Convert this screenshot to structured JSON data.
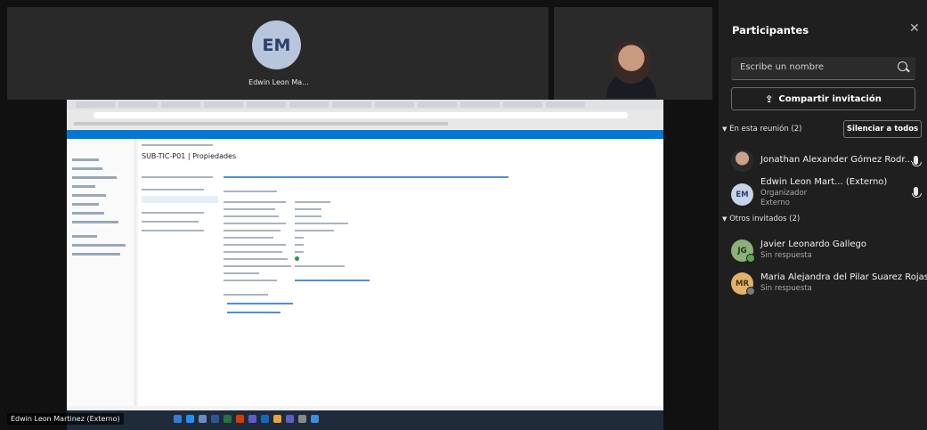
{
  "stage": {
    "main_tile": {
      "initials": "EM",
      "name": "Edwin Leon Ma..."
    },
    "presenter_label": "Edwin Leon Martinez (Externo)",
    "shared_screen": {
      "page_title": "SUB-TIC-P01 | Propiedades"
    }
  },
  "panel": {
    "title": "Participantes",
    "close_icon": "close-icon",
    "search_placeholder": "Escribe un nombre",
    "invite_label": "Compartir invitación",
    "in_meeting_label": "En esta reunión (2)",
    "mute_all_label": "Silenciar a todos",
    "others_label": "Otros invitados (2)",
    "participants": [
      {
        "name": "Jonathan Alexander Gómez Rodr...",
        "role": "",
        "sub": ""
      },
      {
        "initials": "EM",
        "name": "Edwin Leon Mart... (Externo)",
        "role": "Organizador",
        "sub": "Externo"
      }
    ],
    "invitees": [
      {
        "initials": "JG",
        "name": "Javier Leonardo Gallego",
        "status": "Sin respuesta",
        "color": "#8bb07a"
      },
      {
        "initials": "MR",
        "name": "Maria Alejandra del Pilar Suarez Rojas",
        "status": "Sin respuesta",
        "color": "#e0b26a"
      }
    ]
  },
  "colors": {
    "accent": "#0078d4",
    "panel_bg": "#1f1f1f"
  }
}
